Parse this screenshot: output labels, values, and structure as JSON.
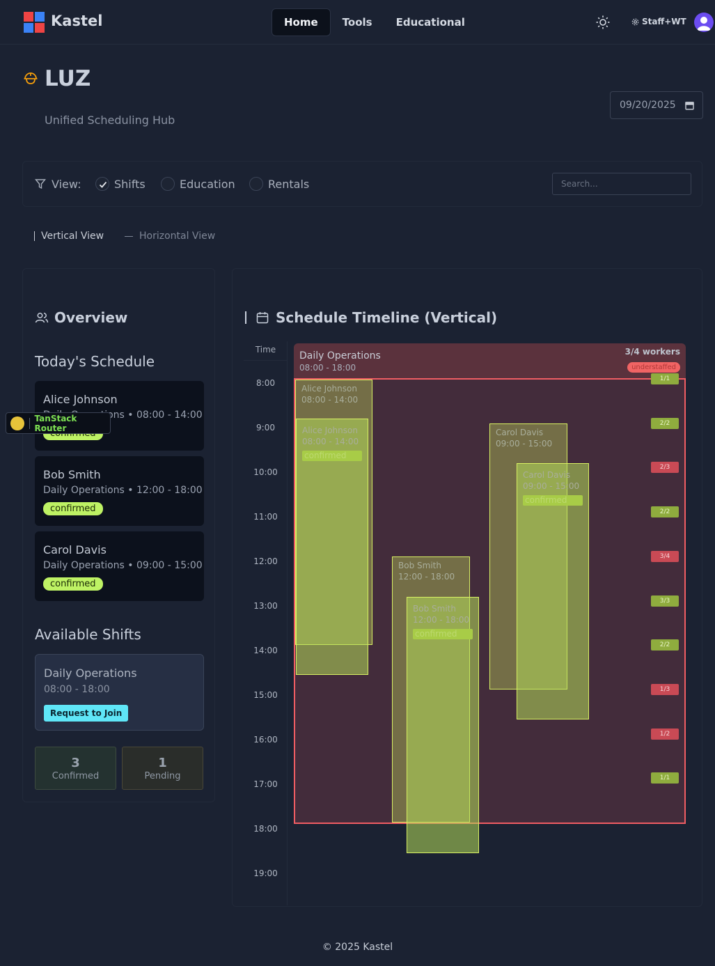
{
  "header": {
    "brand": "Kastel",
    "nav": [
      {
        "label": "Home",
        "active": true
      },
      {
        "label": "Tools",
        "active": false
      },
      {
        "label": "Educational",
        "active": false
      }
    ],
    "theme_icon": "sun-icon",
    "staff_label": "Staff+WT",
    "avatar_icon": "user-icon"
  },
  "page": {
    "title": "LUZ",
    "subtitle": "Unified Scheduling Hub",
    "date_value": "09/20/2025"
  },
  "filters": {
    "view_label": "View:",
    "options": [
      {
        "label": "Shifts",
        "checked": true
      },
      {
        "label": "Education",
        "checked": false
      },
      {
        "label": "Rentals",
        "checked": false
      }
    ],
    "search_placeholder": "Search..."
  },
  "view_toggle": {
    "vertical": "Vertical View",
    "horizontal": "Horizontal View"
  },
  "overview": {
    "title": "Overview",
    "todays_title": "Today's Schedule",
    "schedule": [
      {
        "name": "Alice Johnson",
        "detail": "Daily Operations • 08:00 - 14:00",
        "status": "confirmed"
      },
      {
        "name": "Bob Smith",
        "detail": "Daily Operations • 12:00 - 18:00",
        "status": "confirmed"
      },
      {
        "name": "Carol Davis",
        "detail": "Daily Operations • 09:00 - 15:00",
        "status": "confirmed"
      }
    ],
    "available_title": "Available Shifts",
    "available": {
      "name": "Daily Operations",
      "time": "08:00 - 18:00",
      "button": "Request to Join"
    },
    "stats": [
      {
        "value": "3",
        "label": "Confirmed"
      },
      {
        "value": "1",
        "label": "Pending"
      }
    ]
  },
  "devtools": {
    "label": "TanStack Router"
  },
  "timeline": {
    "title": "Schedule Timeline (Vertical)",
    "time_header": "Time",
    "hours": [
      "8:00",
      "9:00",
      "10:00",
      "11:00",
      "12:00",
      "13:00",
      "14:00",
      "15:00",
      "16:00",
      "17:00",
      "18:00",
      "19:00"
    ],
    "event": {
      "name": "Daily Operations",
      "time": "08:00 - 18:00",
      "workers": "3/4 workers",
      "status": "understaffed"
    },
    "assignments": [
      {
        "name": "Alice Johnson",
        "time": "08:00 - 14:00"
      },
      {
        "name": "Alice Johnson",
        "time": "08:00 - 14:00",
        "status": "confirmed"
      },
      {
        "name": "Carol Davis",
        "time": "09:00 - 15:00"
      },
      {
        "name": "Carol Davis",
        "time": "09:00 - 15:00",
        "status": "confirmed"
      },
      {
        "name": "Bob Smith",
        "time": "12:00 - 18:00"
      },
      {
        "name": "Bob Smith",
        "time": "12:00 - 18:00",
        "status": "confirmed"
      }
    ],
    "hour_ratios": [
      {
        "label": "1/1",
        "ok": true
      },
      {
        "label": "2/2",
        "ok": true
      },
      {
        "label": "2/3",
        "ok": false
      },
      {
        "label": "2/2",
        "ok": true
      },
      {
        "label": "3/4",
        "ok": false
      },
      {
        "label": "3/3",
        "ok": true
      },
      {
        "label": "2/2",
        "ok": true
      },
      {
        "label": "1/3",
        "ok": false
      },
      {
        "label": "1/2",
        "ok": false
      },
      {
        "label": "1/1",
        "ok": true
      }
    ]
  },
  "footer": "© 2025 Kastel",
  "colors": {
    "background": "#1b2232",
    "confirmed": "#bef264",
    "understaffed": "#f16464",
    "join_button": "#5fe6f7",
    "shift_border": "#f05d63"
  }
}
